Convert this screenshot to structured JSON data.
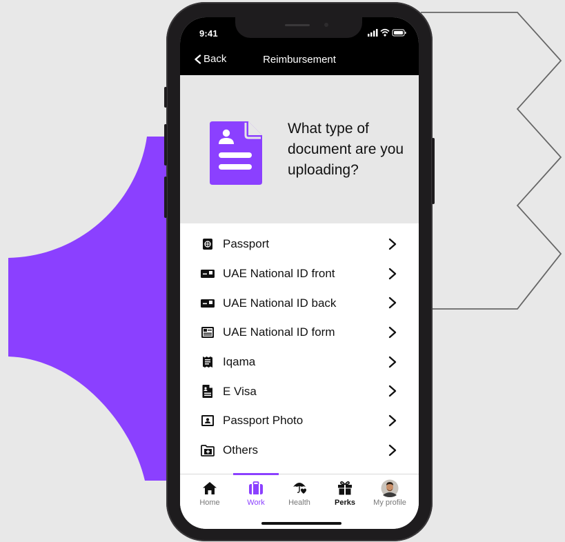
{
  "colors": {
    "accent": "#8b40ff",
    "background": "#e8e8e8",
    "hero": "#e7e7e7"
  },
  "status": {
    "time": "9:41"
  },
  "nav": {
    "back_label": "Back",
    "title": "Reimbursement"
  },
  "hero": {
    "question": "What type of document are you uploading?"
  },
  "document_types": [
    {
      "label": "Passport",
      "icon": "passport-icon"
    },
    {
      "label": "UAE National ID front",
      "icon": "id-card-icon"
    },
    {
      "label": "UAE National ID back",
      "icon": "id-card-icon"
    },
    {
      "label": "UAE National ID form",
      "icon": "id-form-icon"
    },
    {
      "label": "Iqama",
      "icon": "receipt-icon"
    },
    {
      "label": "E Visa",
      "icon": "document-icon"
    },
    {
      "label": "Passport Photo",
      "icon": "portrait-icon"
    },
    {
      "label": "Others",
      "icon": "folder-add-icon"
    }
  ],
  "tabs": [
    {
      "label": "Home",
      "icon": "home-icon",
      "state": "normal"
    },
    {
      "label": "Work",
      "icon": "briefcase-icon",
      "state": "active"
    },
    {
      "label": "Health",
      "icon": "umbrella-heart-icon",
      "state": "normal"
    },
    {
      "label": "Perks",
      "icon": "gift-icon",
      "state": "bold"
    },
    {
      "label": "My profile",
      "icon": "avatar-icon",
      "state": "normal"
    }
  ]
}
